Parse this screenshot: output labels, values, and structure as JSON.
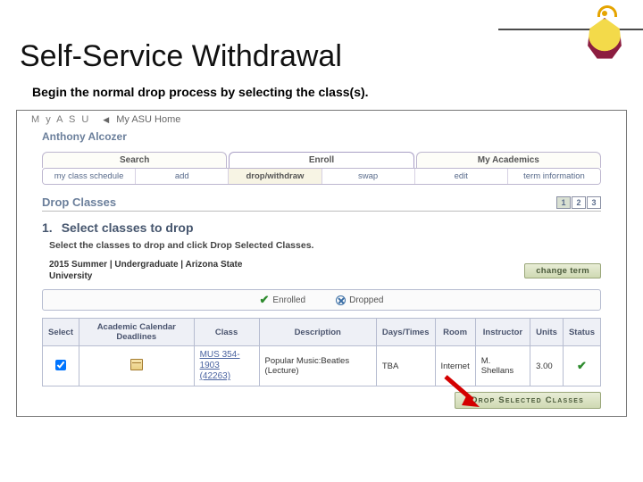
{
  "slide": {
    "title": "Self-Service Withdrawal",
    "instruction": "Begin the normal drop process by selecting the class(s)."
  },
  "topbar": {
    "brand": "M y   A S U",
    "homeLink": "My ASU Home"
  },
  "user": {
    "name": "Anthony Alcozer"
  },
  "tabs_primary": [
    {
      "label": "Search"
    },
    {
      "label": "Enroll"
    },
    {
      "label": "My Academics"
    }
  ],
  "tabs_primary_active_index": 1,
  "tabs_secondary": [
    {
      "label": "my class schedule"
    },
    {
      "label": "add"
    },
    {
      "label": "drop/withdraw"
    },
    {
      "label": "swap"
    },
    {
      "label": "edit"
    },
    {
      "label": "term information"
    }
  ],
  "tabs_secondary_active_index": 2,
  "section": {
    "heading": "Drop Classes",
    "step_number": "1.",
    "step_title": "Select classes to drop",
    "sub_instruction": "Select the classes to drop and click Drop Selected Classes."
  },
  "stepper": {
    "items": [
      "1",
      "2",
      "3"
    ],
    "current": 0
  },
  "term": {
    "label": "2015 Summer | Undergraduate | Arizona State University",
    "change_button": "change term"
  },
  "legend": {
    "enrolled": "Enrolled",
    "dropped": "Dropped"
  },
  "table": {
    "headers": {
      "select": "Select",
      "deadlines": "Academic Calendar Deadlines",
      "class": "Class",
      "description": "Description",
      "days": "Days/Times",
      "room": "Room",
      "instructor": "Instructor",
      "units": "Units",
      "status": "Status"
    },
    "rows": [
      {
        "selected": true,
        "class_code": "MUS 354-1903",
        "class_nbr": "(42263)",
        "description": "Popular Music:Beatles (Lecture)",
        "days_times": "TBA",
        "room": "Internet",
        "instructor": "M. Shellans",
        "units": "3.00",
        "status": "enrolled"
      }
    ]
  },
  "actions": {
    "drop_button": "Drop Selected Classes"
  }
}
